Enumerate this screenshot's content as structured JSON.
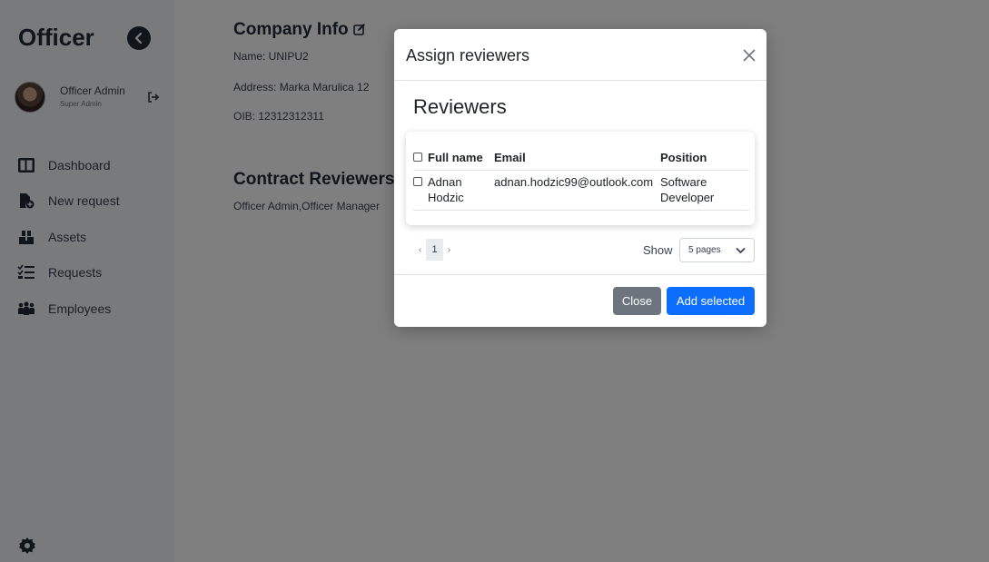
{
  "sidebar": {
    "brand": "Officer",
    "user": {
      "name": "Officer Admin",
      "role": "Super Admin"
    },
    "nav": [
      {
        "label": "Dashboard",
        "icon": "dashboard-icon"
      },
      {
        "label": "New request",
        "icon": "new-request-icon"
      },
      {
        "label": "Assets",
        "icon": "assets-icon"
      },
      {
        "label": "Requests",
        "icon": "requests-icon"
      },
      {
        "label": "Employees",
        "icon": "employees-icon"
      }
    ]
  },
  "main": {
    "company_title": "Company Info",
    "name_line": "Name: UNIPU2",
    "address_line": "Address: Marka Marulica 12",
    "oib_line": "OIB: 12312312311",
    "reviewers_title": "Contract Reviewers",
    "reviewers_line": "Officer Admin,Officer Manager"
  },
  "modal": {
    "title": "Assign reviewers",
    "heading": "Reviewers",
    "columns": [
      "Full name",
      "Email",
      "Position"
    ],
    "rows": [
      {
        "name_first": "Adnan",
        "name_last": "Hodzic",
        "email": "adnan.hodzic99@outlook.com",
        "position_1": "Software",
        "position_2": "Developer"
      }
    ],
    "pagination": {
      "prev": "‹",
      "current": "1",
      "next": "›"
    },
    "show_label": "Show",
    "page_size": "5 pages",
    "close_label": "Close",
    "add_label": "Add selected"
  },
  "colors": {
    "primary": "#0d6efd",
    "secondary": "#6c757d",
    "backdrop": "rgba(0,0,0,0.5)",
    "brand_text": "#1f2a37"
  }
}
